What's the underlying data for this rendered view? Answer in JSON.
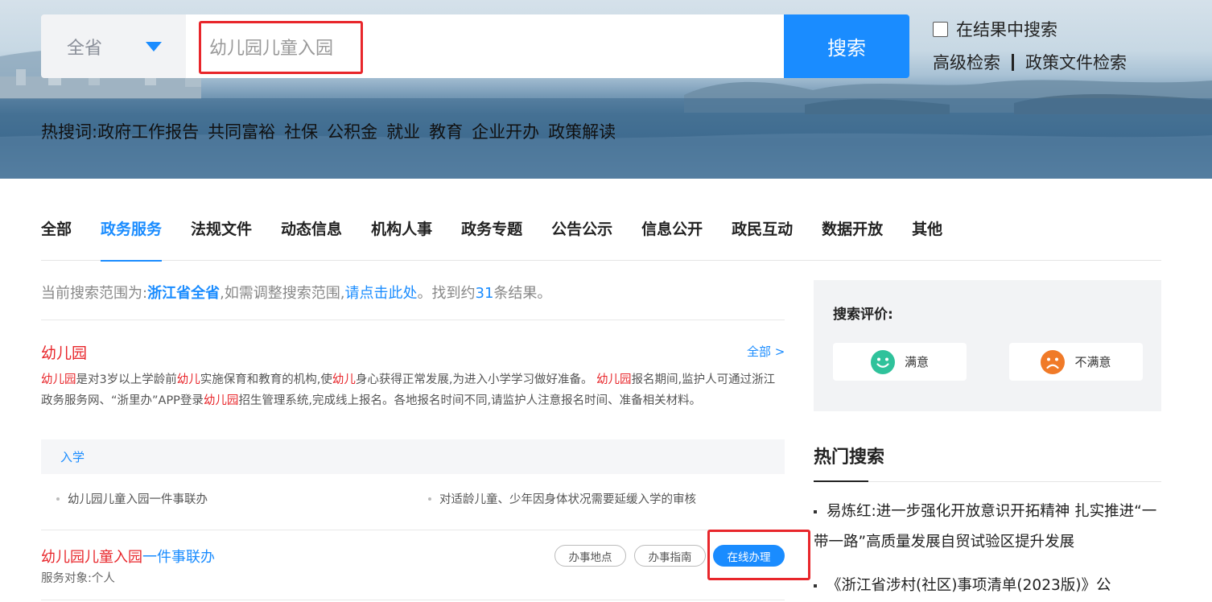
{
  "search": {
    "region": "全省",
    "query": "幼儿园儿童入园",
    "button_label": "搜索",
    "in_result_label": "在结果中搜索",
    "advanced_label": "高级检索",
    "policy_label": "政策文件检索"
  },
  "hot_words": {
    "label": "热搜词:",
    "items": [
      "政府工作报告",
      "共同富裕",
      "社保",
      "公积金",
      "就业",
      "教育",
      "企业开办",
      "政策解读"
    ]
  },
  "tabs": [
    "全部",
    "政务服务",
    "法规文件",
    "动态信息",
    "机构人事",
    "政务专题",
    "公告公示",
    "信息公开",
    "政民互动",
    "数据开放",
    "其他"
  ],
  "scope": {
    "prefix": "当前搜索范围为:",
    "region": "浙江省全省",
    "middle": ",如需调整搜索范围,",
    "link": "请点击此处",
    "found_prefix": "。找到约",
    "count": "31",
    "found_suffix": "条结果。"
  },
  "card": {
    "title": "幼儿园",
    "all_link": "全部 >",
    "desc": {
      "p1_kw1": "幼儿园",
      "p1_t1": "是对3岁以上学龄前",
      "p1_kw2": "幼儿",
      "p1_t2": "实施保育和教育的机构,使",
      "p1_kw3": "幼儿",
      "p1_t3": "身心获得正常发展,为进入小学学习做好准备。 ",
      "p2_kw1": "幼儿园",
      "p2_t1": "报名期间,监护人可通过浙江政务服务网、“浙里办”APP登录",
      "p2_kw2": "幼儿园",
      "p2_t2": "招生管理系统,完成线上报名。各地报名时间不同,请监护人注意报名时间、准备相关材料。"
    },
    "category": "入学",
    "items": [
      "幼儿园儿童入园一件事联办",
      "对适龄儿童、少年因身体状况需要延缓入学的审核"
    ]
  },
  "result2": {
    "title_kw": "幼儿园儿童入园",
    "title_rest": "一件事联办",
    "subtitle": "服务对象:个人",
    "btn_location": "办事地点",
    "btn_guide": "办事指南",
    "btn_online": "在线办理"
  },
  "evaluation": {
    "title": "搜索评价:",
    "satisfied": "满意",
    "unsatisfied": "不满意",
    "satisfied_color": "#2fc29b",
    "unsatisfied_color": "#f07a28"
  },
  "hot_search": {
    "title": "热门搜索",
    "items": [
      "易炼红:进一步强化开放意识开拓精神 扎实推进“一带一路”高质量发展自贸试验区提升发展",
      "《浙江省涉村(社区)事项清单(2023版)》公"
    ]
  },
  "colors": {
    "accent": "#1a8cff",
    "keyword": "#e8262b"
  }
}
